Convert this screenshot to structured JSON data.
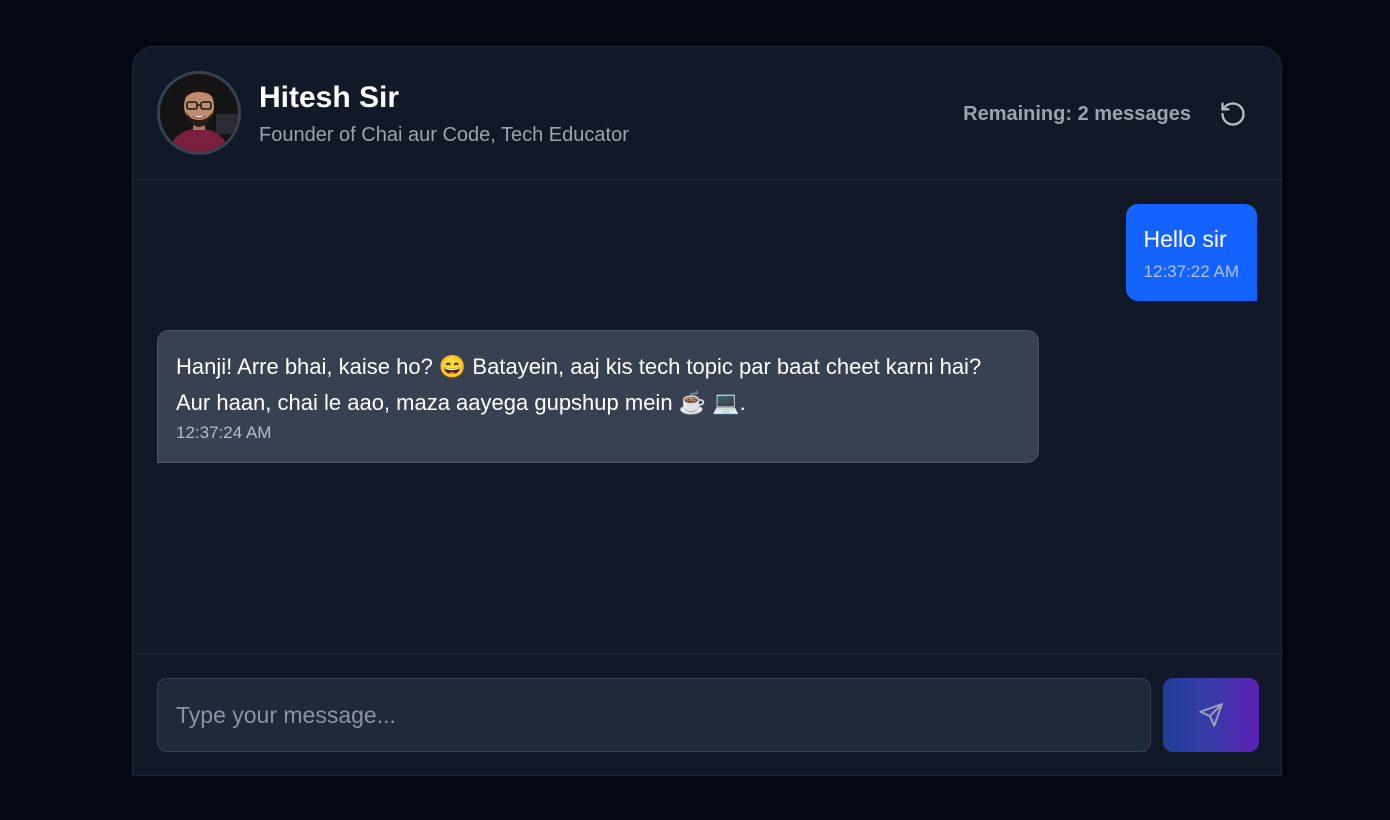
{
  "header": {
    "name": "Hitesh Sir",
    "role": "Founder of Chai aur Code, Tech Educator",
    "remaining": "Remaining: 2 messages",
    "avatar_icon": "avatar-photo",
    "reset_icon": "rotate-ccw-icon"
  },
  "messages": [
    {
      "sender": "user",
      "text": "Hello sir",
      "time": "12:37:22 AM"
    },
    {
      "sender": "bot",
      "text": "Hanji! Arre bhai, kaise ho? 😄 Batayein, aaj kis tech topic par baat cheet karni hai? Aur haan, chai le aao, maza aayega gupshup mein ☕ 💻.",
      "time": "12:37:24 AM"
    }
  ],
  "composer": {
    "placeholder": "Type your message...",
    "value": "",
    "send_icon": "send-icon"
  },
  "colors": {
    "background": "#040812",
    "panel": "#111827",
    "user_bubble": "#1462ff",
    "bot_bubble": "#374151",
    "send_gradient_start": "#213f9a",
    "send_gradient_end": "#5b21b6"
  }
}
